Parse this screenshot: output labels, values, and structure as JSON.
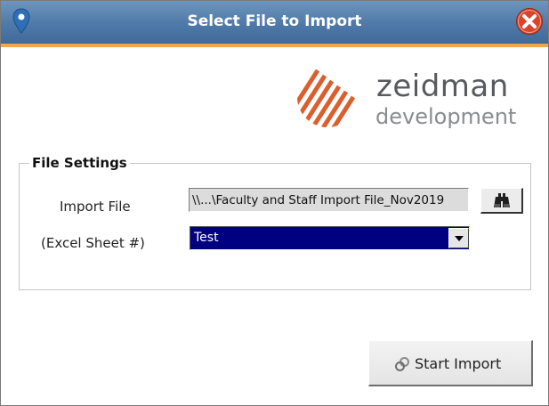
{
  "window": {
    "title": "Select File to Import",
    "pin_icon": "map-pin-icon",
    "close_icon": "close-icon"
  },
  "logo": {
    "line1": "zeidman",
    "line2": "development"
  },
  "file_settings": {
    "legend": "File Settings",
    "import_file_label": "Import File",
    "import_file_value": "\\\\...\\Faculty and Staff Import File_Nov2019",
    "browse_icon": "binoculars-icon",
    "sheet_label": "(Excel Sheet #)",
    "sheet_selected": "Test"
  },
  "actions": {
    "start_import_label": "Start Import",
    "start_import_icon": "link-icon"
  },
  "colors": {
    "title_bar": "#4e79a8",
    "title_accent": "#f0a64a",
    "close_red": "#d9452b",
    "logo_red": "#c7322f",
    "logo_orange": "#f08a2c",
    "selection_blue": "#000080"
  }
}
